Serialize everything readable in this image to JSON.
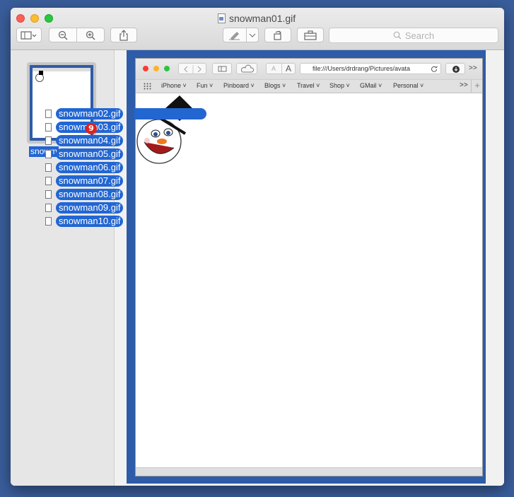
{
  "window": {
    "title": "snowman01.gif"
  },
  "toolbar": {
    "search_placeholder": "Search",
    "buttons": [
      "sidebar-toggle",
      "zoom-out",
      "zoom-in",
      "share",
      "markup",
      "rotate",
      "toolbox"
    ]
  },
  "sidebar": {
    "thumbnail_label": "snowm"
  },
  "inner_browser": {
    "address": "file:///Users/drdrang/Pictures/avata",
    "text_small": "A",
    "text_large": "A",
    "overflow": ">>",
    "bookmarks": [
      {
        "label": "iPhone"
      },
      {
        "label": "Fun"
      },
      {
        "label": "Pinboard"
      },
      {
        "label": "Blogs"
      },
      {
        "label": "Travel"
      },
      {
        "label": "Shop"
      },
      {
        "label": "GMail"
      },
      {
        "label": "Personal"
      }
    ],
    "bookmarks_overflow": ">>",
    "add": "+"
  },
  "drag": {
    "count_badge": "9",
    "files": [
      {
        "name": "snowman02.gif"
      },
      {
        "name": "snowman03.gif"
      },
      {
        "name": "snowman04.gif"
      },
      {
        "name": "snowman05.gif"
      },
      {
        "name": "snowman06.gif"
      },
      {
        "name": "snowman07.gif"
      },
      {
        "name": "snowman08.gif"
      },
      {
        "name": "snowman09.gif"
      },
      {
        "name": "snowman10.gif"
      }
    ]
  },
  "colors": {
    "selection": "#2266d2",
    "desktop": "#3a5e9c",
    "badge": "#e0221e"
  }
}
